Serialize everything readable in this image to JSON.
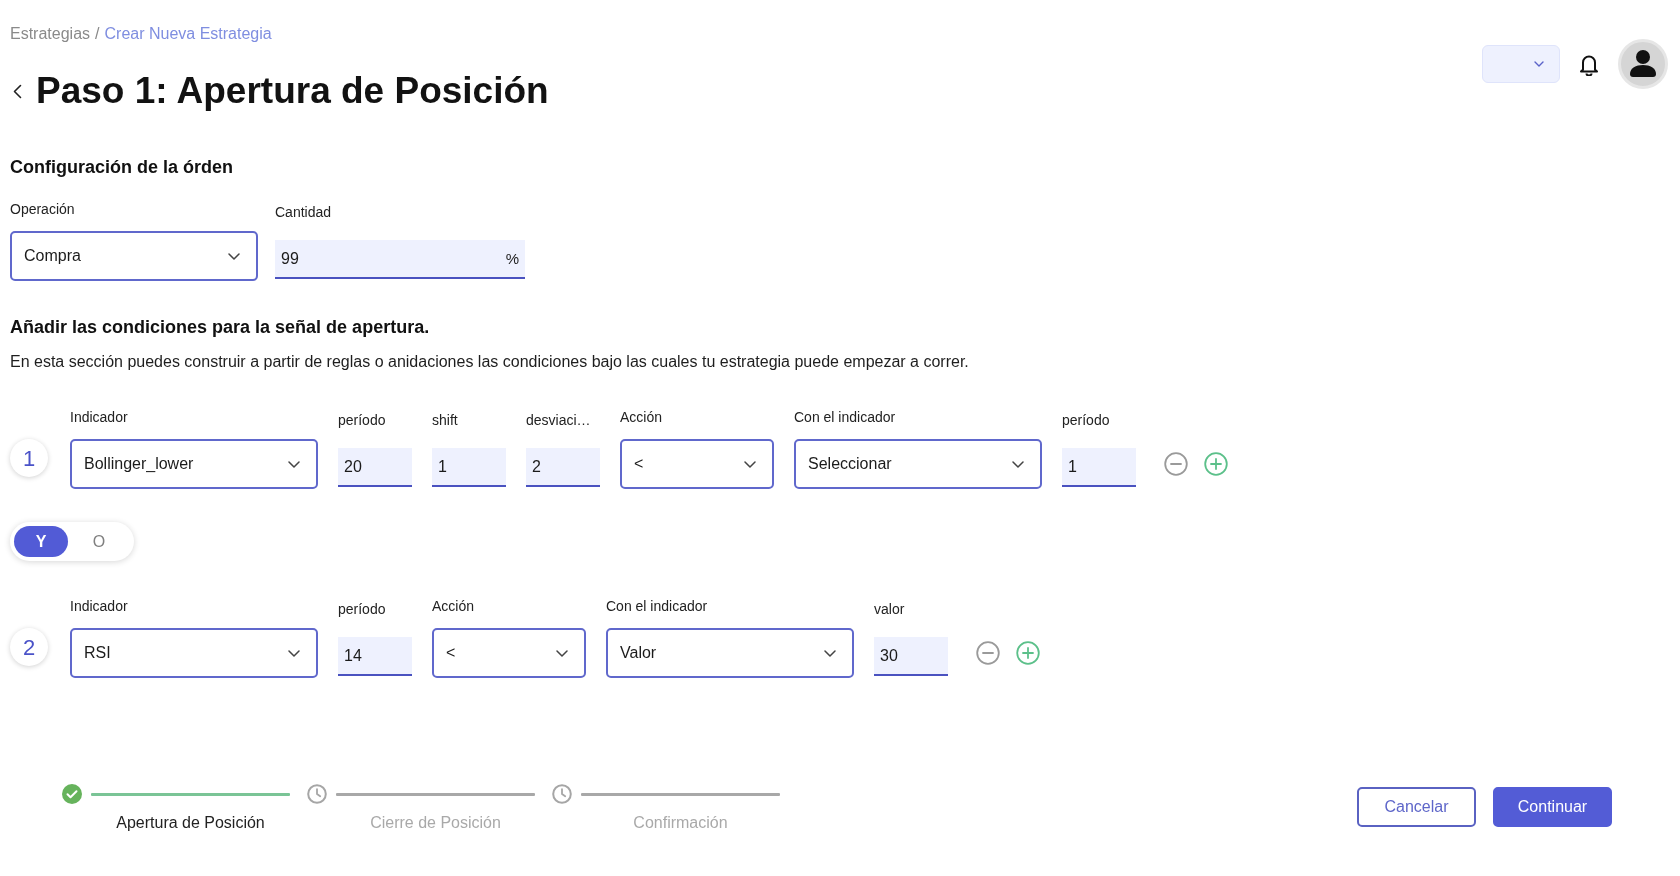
{
  "breadcrumb": {
    "separator": "/",
    "items": [
      {
        "label": "Estrategias",
        "selected": false
      },
      {
        "label": "Crear Nueva Estrategia",
        "selected": true
      }
    ]
  },
  "title": "Paso 1: Apertura de Posición",
  "order_config": {
    "title": "Configuración de la órden",
    "fields": [
      {
        "kind": "select",
        "label": "Operación",
        "value": "Compra"
      },
      {
        "kind": "input",
        "label": "Cantidad",
        "value": "99",
        "suffix": "%"
      }
    ]
  },
  "conditions": {
    "title": "Añadir las condiciones para la señal de apertura.",
    "description": "En esta sección puedes construir a partir de reglas o anidaciones las condiciones bajo las cuales tu estrategia puede empezar a correr.",
    "items": [
      {
        "kind": "condition",
        "number": "1",
        "fields": [
          {
            "kind": "select",
            "label": "Indicador",
            "value": "Bollinger_lower"
          },
          {
            "kind": "input",
            "label": "período",
            "value": "20"
          },
          {
            "kind": "input",
            "label": "shift",
            "value": "1"
          },
          {
            "kind": "input",
            "label": "desviaci…",
            "value": "2"
          },
          {
            "kind": "operator",
            "label": "Acción",
            "value": "<"
          },
          {
            "kind": "select",
            "label": "Con el indicador",
            "value": "Seleccionar"
          },
          {
            "kind": "input",
            "label": "período",
            "value": "1"
          }
        ]
      },
      {
        "kind": "connector",
        "options": [
          {
            "label": "Y",
            "selected": true
          },
          {
            "label": "O",
            "selected": false
          }
        ]
      },
      {
        "kind": "condition",
        "number": "2",
        "fields": [
          {
            "kind": "select",
            "label": "Indicador",
            "value": "RSI"
          },
          {
            "kind": "input",
            "label": "período",
            "value": "14"
          },
          {
            "kind": "operator",
            "label": "Acción",
            "value": "<"
          },
          {
            "kind": "select",
            "label": "Con el indicador",
            "value": "Valor"
          },
          {
            "kind": "input",
            "label": "valor",
            "value": "30"
          }
        ]
      }
    ]
  },
  "stepper": [
    {
      "label": "Apertura de Posición",
      "completed": true
    },
    {
      "label": "Cierre de Posición",
      "completed": false
    },
    {
      "label": "Confirmación",
      "completed": false
    }
  ],
  "actions": [
    {
      "label": "Cancelar",
      "kind": "outline"
    },
    {
      "label": "Continuar",
      "kind": "primary"
    }
  ]
}
